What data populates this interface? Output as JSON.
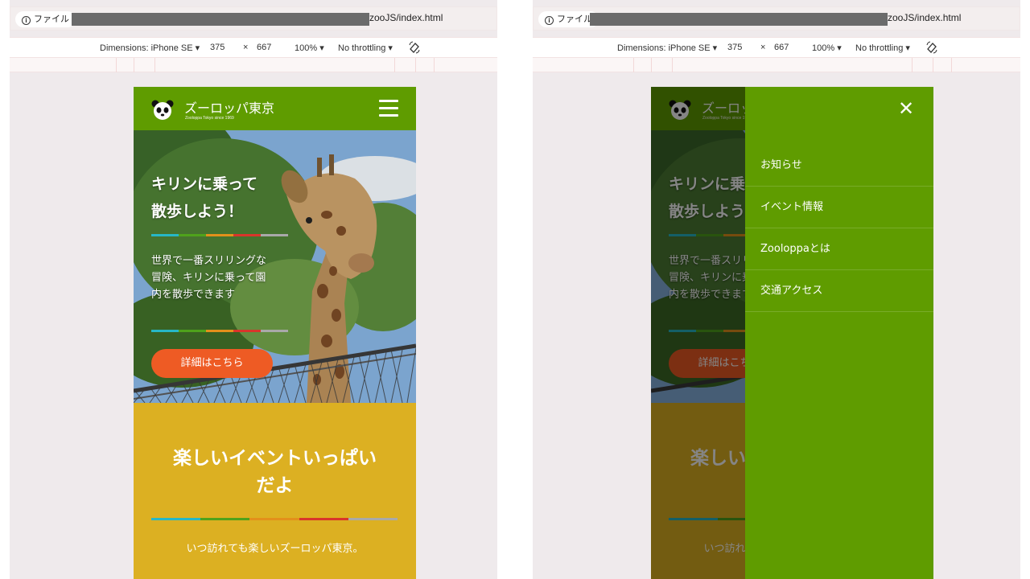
{
  "browser": {
    "info_label": "ファイル",
    "url_suffix": "zooJS/index.html"
  },
  "devtools": {
    "device": "Dimensions: iPhone SE ▾",
    "width": "375",
    "times": "×",
    "height": "667",
    "zoom": "100% ▾",
    "throttle": "No throttling ▾"
  },
  "site": {
    "brand_title": "ズーロッパ東京",
    "brand_sub": "Zooloppa Tokyo since 1969",
    "hero_title": "キリンに乗って\n散歩しよう！",
    "hero_text": "世界で一番スリリングな\n冒険、キリンに乗って園\n内を散歩できます",
    "hero_button": "詳細はこちら",
    "event_title": "楽しいイベントいっぱい\nだよ",
    "event_text": "いつ訪れても楽しいズーロッパ東京。",
    "stripe_colors": [
      "#27b7c6",
      "#4fa21b",
      "#e3901b",
      "#d9352b",
      "#a9a9a9"
    ],
    "colors": {
      "header_green": "#5f9c00",
      "section_yellow": "#dcb022",
      "cta_orange": "#ee5b24"
    }
  },
  "menu": {
    "items": [
      "お知らせ",
      "イベント情報",
      "Zooloppaとは",
      "交通アクセス"
    ],
    "close_icon": "close-icon"
  }
}
